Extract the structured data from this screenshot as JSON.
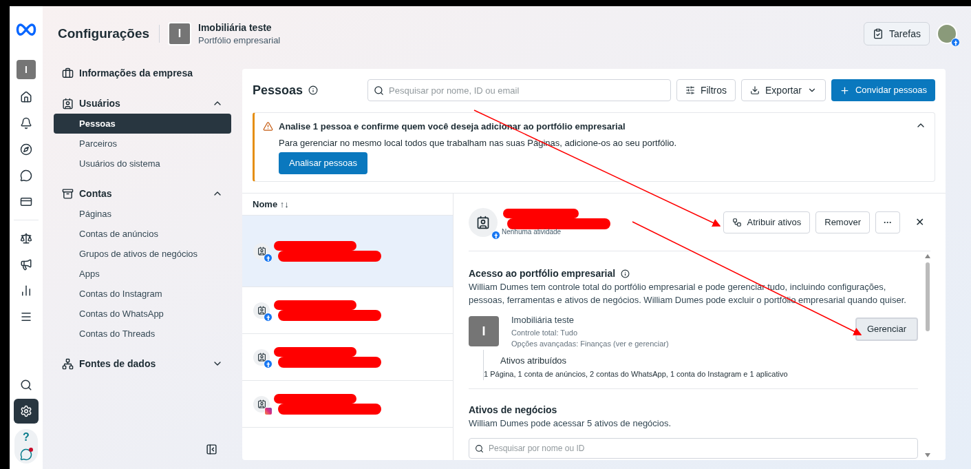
{
  "header": {
    "title": "Configurações",
    "portfolio_initial": "I",
    "portfolio_name": "Imobiliária teste",
    "portfolio_type": "Portfólio empresarial",
    "tasks_button": "Tarefas"
  },
  "rail": {
    "business_initial": "I",
    "help": "?",
    "items": [
      {
        "kind": "home",
        "selected": false
      },
      {
        "kind": "bell",
        "selected": false
      },
      {
        "kind": "compass",
        "selected": false
      },
      {
        "kind": "chat",
        "selected": false
      },
      {
        "kind": "cards",
        "selected": false
      }
    ],
    "items2": [
      {
        "kind": "scale",
        "selected": false
      },
      {
        "kind": "megaphone",
        "selected": false
      },
      {
        "kind": "bars",
        "selected": false
      },
      {
        "kind": "menu",
        "selected": false
      }
    ],
    "search_selected": false,
    "settings_selected": true,
    "chat_alert": true
  },
  "sidebar": {
    "sections": [
      {
        "kind": "briefcase",
        "label": "Informações da empresa",
        "expandable": false,
        "expanded": false
      },
      {
        "kind": "badge",
        "label": "Usuários",
        "expandable": true,
        "expanded": true,
        "items": [
          {
            "label": "Pessoas",
            "selected": true
          },
          {
            "label": "Parceiros",
            "selected": false
          },
          {
            "label": "Usuários do sistema",
            "selected": false
          }
        ]
      },
      {
        "kind": "box",
        "label": "Contas",
        "expandable": true,
        "expanded": true,
        "items": [
          {
            "label": "Páginas",
            "selected": false
          },
          {
            "label": "Contas de anúncios",
            "selected": false
          },
          {
            "label": "Grupos de ativos de negócios",
            "selected": false
          },
          {
            "label": "Apps",
            "selected": false
          },
          {
            "label": "Contas do Instagram",
            "selected": false
          },
          {
            "label": "Contas do WhatsApp",
            "selected": false
          },
          {
            "label": "Contas do Threads",
            "selected": false
          }
        ]
      },
      {
        "kind": "nodes",
        "label": "Fontes de dados",
        "expandable": true,
        "expanded": false
      }
    ]
  },
  "people_panel": {
    "title": "Pessoas",
    "search": {
      "placeholder": "Pesquisar por nome, ID ou email"
    },
    "filters_button": "Filtros",
    "export_button": "Exportar",
    "invite_button": "Convidar pessoas",
    "alert": {
      "title": "Analise 1 pessoa e confirme quem você deseja adicionar ao portfólio empresarial",
      "text": "Para gerenciar no mesmo local todos que trabalham nas suas Páginas, adicione-os ao seu portfólio.",
      "button": "Analisar pessoas",
      "expanded": true
    },
    "list_header": "Nome ↑↓",
    "people": [
      {
        "kind": "facebook",
        "selected": true
      },
      {
        "kind": "facebook",
        "selected": false
      },
      {
        "kind": "facebook",
        "selected": false
      },
      {
        "kind": "instagram",
        "selected": false
      }
    ]
  },
  "detail": {
    "status": "Nenhuma atividade",
    "avatar": {
      "kind": "facebook"
    },
    "assign_button": "Atribuir ativos",
    "remove_button": "Remover",
    "more_button": "···",
    "close_button": "✕",
    "access_title": "Acesso ao portfólio empresarial",
    "access_text": "William Dumes tem controle total do portfólio empresarial e pode gerenciar tudo, incluindo configurações, pessoas, ferramentas e ativos de negócios. William Dumes pode excluir o portfólio empresarial quando quiser.",
    "portfolio_initial": "I",
    "portfolio_name": "Imobiliária teste",
    "control": "Controle total: Tudo",
    "advanced": "Opções avançadas: Finanças (ver e gerenciar)",
    "manage_button": "Gerenciar",
    "assigned_title": "Ativos atribuídos",
    "assigned_text": "1 Página, 1 conta de anúncios, 2 contas do WhatsApp, 1 conta do Instagram e 1 aplicativo",
    "business_title": "Ativos de negócios",
    "business_text": "William Dumes pode acessar 5 ativos de negócios.",
    "asset_search": {
      "placeholder": "Pesquisar por nome ou ID"
    }
  }
}
